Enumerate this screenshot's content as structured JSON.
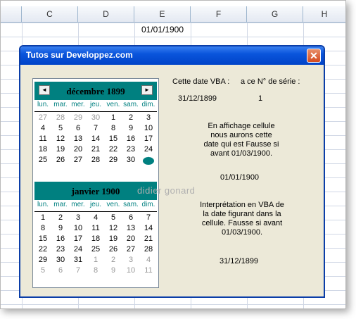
{
  "sheet": {
    "columns": [
      "C",
      "D",
      "E",
      "F",
      "G",
      "H"
    ],
    "cell_e1": "01/01/1900"
  },
  "dialog": {
    "title": "Tutos sur Developpez.com",
    "close_glyph": "✕",
    "labels": {
      "date_vba": "Cette date VBA :",
      "serial": "a ce N° de série :",
      "date_value": "31/12/1899",
      "serial_value": "1",
      "cell_display_note": "En affichage cellule\nnous aurons  cette\ndate qui est  Fausse si\navant 01/03/1900.",
      "cell_display_value": "01/01/1900",
      "vba_interp_note": "Interprétation en VBA de\nla date figurant dans la\ncellule. Fausse si avant\n01/03/1900.",
      "vba_interp_value": "31/12/1899"
    },
    "watermark": "didier gonard"
  },
  "calendar": {
    "dow": [
      "lun.",
      "mar.",
      "mer.",
      "jeu.",
      "ven.",
      "sam.",
      "dim."
    ],
    "prev_glyph": "◄",
    "next_glyph": "►",
    "month1": {
      "title": "décembre 1899",
      "weeks": [
        [
          "27",
          "28",
          "29",
          "30",
          "1",
          "2",
          "3"
        ],
        [
          "4",
          "5",
          "6",
          "7",
          "8",
          "9",
          "10"
        ],
        [
          "11",
          "12",
          "13",
          "14",
          "15",
          "16",
          "17"
        ],
        [
          "18",
          "19",
          "20",
          "21",
          "22",
          "23",
          "24"
        ],
        [
          "25",
          "26",
          "27",
          "28",
          "29",
          "30",
          "31"
        ]
      ],
      "grey": [
        [
          0,
          0
        ],
        [
          0,
          1
        ],
        [
          0,
          2
        ],
        [
          0,
          3
        ]
      ],
      "selected": [
        4,
        6
      ]
    },
    "month2": {
      "title": "janvier 1900",
      "weeks": [
        [
          "1",
          "2",
          "3",
          "4",
          "5",
          "6",
          "7"
        ],
        [
          "8",
          "9",
          "10",
          "11",
          "12",
          "13",
          "14"
        ],
        [
          "15",
          "16",
          "17",
          "18",
          "19",
          "20",
          "21"
        ],
        [
          "22",
          "23",
          "24",
          "25",
          "26",
          "27",
          "28"
        ],
        [
          "29",
          "30",
          "31",
          "1",
          "2",
          "3",
          "4"
        ],
        [
          "5",
          "6",
          "7",
          "8",
          "9",
          "10",
          "11"
        ]
      ],
      "grey": [
        [
          4,
          3
        ],
        [
          4,
          4
        ],
        [
          4,
          5
        ],
        [
          4,
          6
        ],
        [
          5,
          0
        ],
        [
          5,
          1
        ],
        [
          5,
          2
        ],
        [
          5,
          3
        ],
        [
          5,
          4
        ],
        [
          5,
          5
        ],
        [
          5,
          6
        ]
      ]
    },
    "colors": {
      "header": "#008080",
      "dow_text": "#008080",
      "grey_day": "#999999"
    }
  }
}
